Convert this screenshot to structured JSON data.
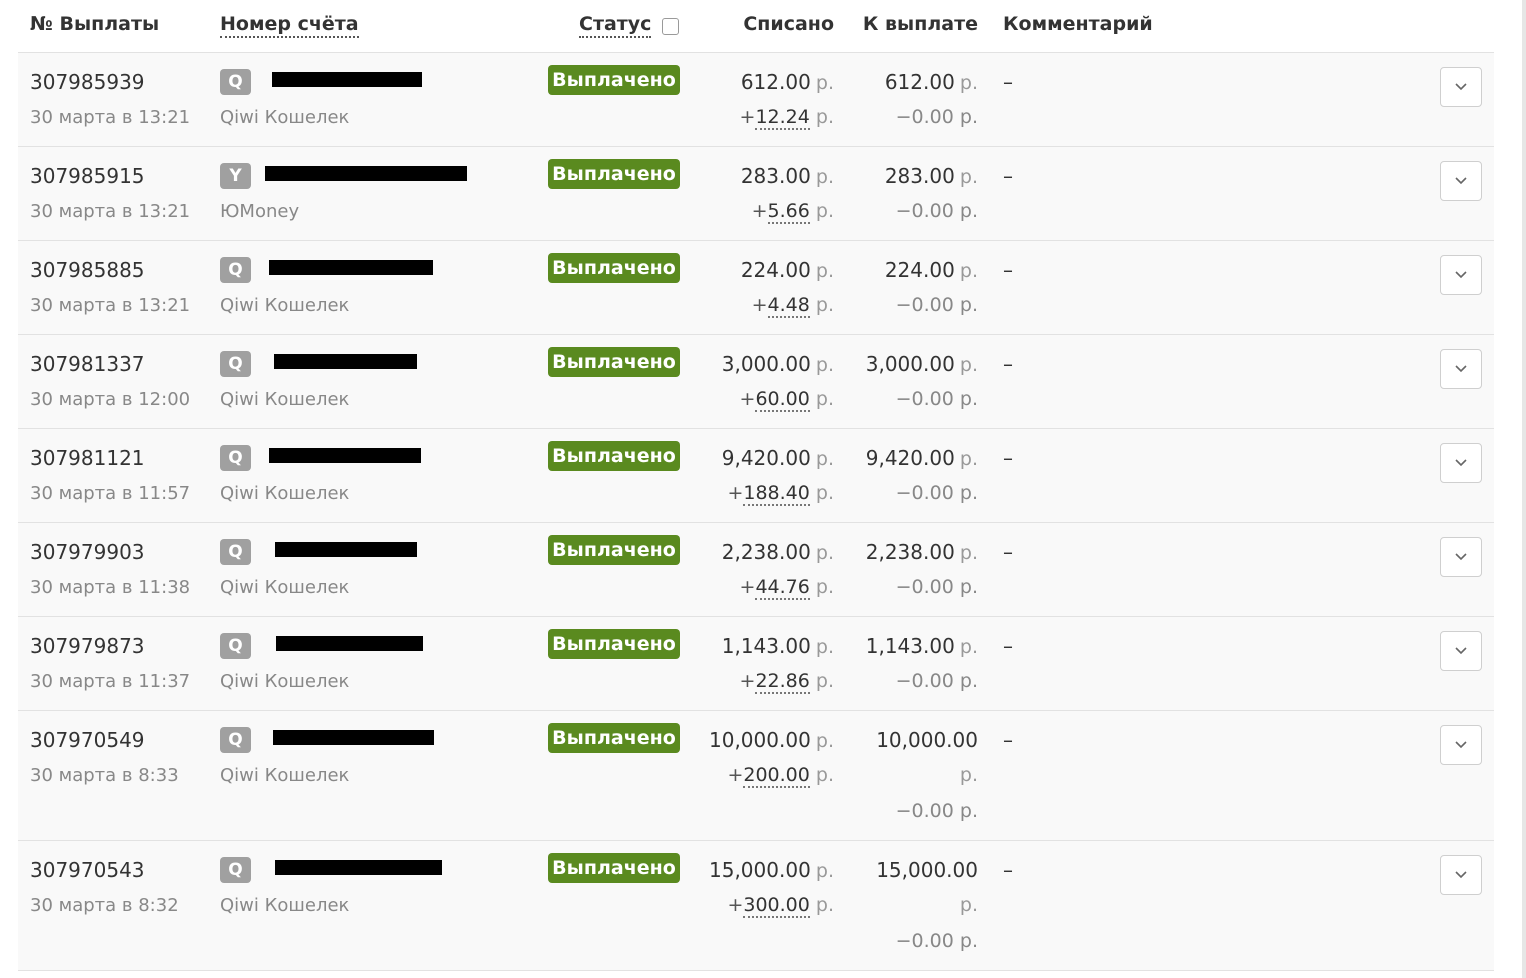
{
  "header": {
    "payout_number": "№ Выплаты",
    "account_number": "Номер счёта",
    "status": "Статус",
    "debited": "Списано",
    "to_payout": "К выплате",
    "comment": "Комментарий"
  },
  "currency": "р.",
  "status_label": "Выплачено",
  "icons": {
    "expand": "chevron-down-icon",
    "qiwi": "Q",
    "yoomoney": "Y"
  },
  "colors": {
    "status_bg": "#5a8a1f",
    "row_bg": "#f9f9f9",
    "badge_bg": "#a0a0a0"
  },
  "rows": [
    {
      "id": "307985939",
      "date": "30 марта в 13:21",
      "badge": "Q",
      "account_type": "Qiwi Кошелек",
      "debit": "612.00",
      "fee": "12.24",
      "payout": "612.00",
      "deduct": "−0.00",
      "comment": "–"
    },
    {
      "id": "307985915",
      "date": "30 марта в 13:21",
      "badge": "Y",
      "account_type": "ЮMoney",
      "debit": "283.00",
      "fee": "5.66",
      "payout": "283.00",
      "deduct": "−0.00",
      "comment": "–"
    },
    {
      "id": "307985885",
      "date": "30 марта в 13:21",
      "badge": "Q",
      "account_type": "Qiwi Кошелек",
      "debit": "224.00",
      "fee": "4.48",
      "payout": "224.00",
      "deduct": "−0.00",
      "comment": "–"
    },
    {
      "id": "307981337",
      "date": "30 марта в 12:00",
      "badge": "Q",
      "account_type": "Qiwi Кошелек",
      "debit": "3,000.00",
      "fee": "60.00",
      "payout": "3,000.00",
      "deduct": "−0.00",
      "comment": "–"
    },
    {
      "id": "307981121",
      "date": "30 марта в 11:57",
      "badge": "Q",
      "account_type": "Qiwi Кошелек",
      "debit": "9,420.00",
      "fee": "188.40",
      "payout": "9,420.00",
      "deduct": "−0.00",
      "comment": "–"
    },
    {
      "id": "307979903",
      "date": "30 марта в 11:38",
      "badge": "Q",
      "account_type": "Qiwi Кошелек",
      "debit": "2,238.00",
      "fee": "44.76",
      "payout": "2,238.00",
      "deduct": "−0.00",
      "comment": "–"
    },
    {
      "id": "307979873",
      "date": "30 марта в 11:37",
      "badge": "Q",
      "account_type": "Qiwi Кошелек",
      "debit": "1,143.00",
      "fee": "22.86",
      "payout": "1,143.00",
      "deduct": "−0.00",
      "comment": "–"
    },
    {
      "id": "307970549",
      "date": "30 марта в 8:33",
      "badge": "Q",
      "account_type": "Qiwi Кошелек",
      "debit": "10,000.00",
      "fee": "200.00",
      "payout": "10,000.00",
      "deduct": "−0.00",
      "comment": "–"
    },
    {
      "id": "307970543",
      "date": "30 марта в 8:32",
      "badge": "Q",
      "account_type": "Qiwi Кошелек",
      "debit": "15,000.00",
      "fee": "300.00",
      "payout": "15,000.00",
      "deduct": "−0.00",
      "comment": "–"
    }
  ]
}
